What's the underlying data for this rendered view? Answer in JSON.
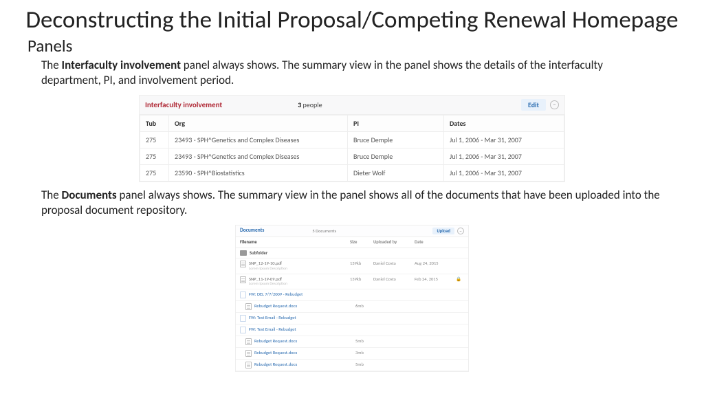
{
  "title": "Deconstructing the Initial Proposal/Competing Renewal Homepage",
  "section": "Panels",
  "para1_a": "The ",
  "para1_b": "Interfaculty involvement",
  "para1_c": " panel always shows. The summary view in the panel shows the details of the interfaculty department, PI, and involvement period.",
  "para2_a": "The ",
  "para2_b": "Documents",
  "para2_c": " panel always shows. The summary view in the panel shows all of the documents that have been uploaded into the proposal document repository.",
  "panel1": {
    "title": "Interfaculty involvement",
    "count_num": "3",
    "count_label": " people",
    "edit": "Edit",
    "headers": {
      "tub": "Tub",
      "org": "Org",
      "pi": "PI",
      "dates": "Dates"
    },
    "rows": [
      {
        "tub": "275",
        "org": "23493 - SPH^Genetics and Complex Diseases",
        "pi": "Bruce Demple",
        "dates": "Jul 1, 2006 - Mar 31, 2007"
      },
      {
        "tub": "275",
        "org": "23493 - SPH^Genetics and Complex Diseases",
        "pi": "Bruce Demple",
        "dates": "Jul 1, 2006 - Mar 31, 2007"
      },
      {
        "tub": "275",
        "org": "23590 - SPH^Biostatistics",
        "pi": "Dieter Wolf",
        "dates": "Jul 1, 2006 - Mar 31, 2007"
      }
    ]
  },
  "panel2": {
    "title": "Documents",
    "count": "5  Documents",
    "upload": "Upload",
    "headers": {
      "filename": "Filename",
      "size": "Size",
      "uploaded": "Uploaded by",
      "date": "Date"
    },
    "subfolder": "Subfolder",
    "desc": "Lorem Ipsum Description",
    "rows": [
      {
        "name": "SNP_12-19-10.pdf",
        "size": "139kb",
        "by": "Daniel Costa",
        "date": "Aug 24, 2015",
        "lock": ""
      },
      {
        "name": "SNP_11-19-09.pdf",
        "size": "139kb",
        "by": "Daniel Costa",
        "date": "Feb 24, 2015",
        "lock": "🔒"
      }
    ],
    "mail1": "FW: DEL 7/7/2009 - Rebudget",
    "mail1_att": "Rebudget Request.docx",
    "mail1_size": "6mb",
    "mail2": "FW: Test Email - Rebudget",
    "mail3": "FW: Test Email - Rebudget",
    "mail3_att": "Rebudget Request.docx",
    "mail3_s1": "5mb",
    "mail3_s2": "3mb",
    "mail3_s3": "5mb"
  }
}
